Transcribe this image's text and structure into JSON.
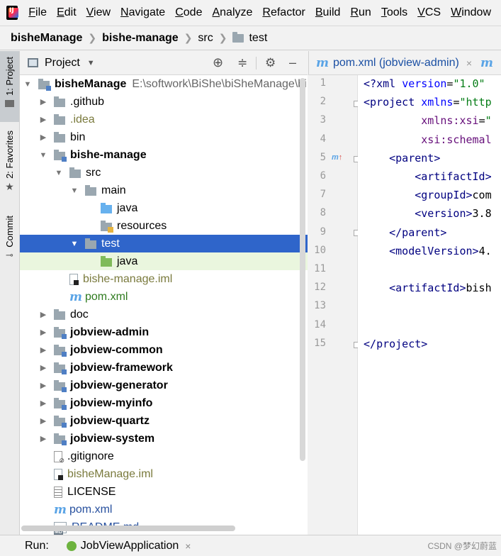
{
  "menubar": {
    "items": [
      "File",
      "Edit",
      "View",
      "Navigate",
      "Code",
      "Analyze",
      "Refactor",
      "Build",
      "Run",
      "Tools",
      "VCS",
      "Window"
    ]
  },
  "breadcrumb": {
    "items": [
      "bisheManage",
      "bishe-manage",
      "src",
      "test"
    ]
  },
  "left_stripe": {
    "project_label": "1: Project",
    "favorites_label": "2: Favorites",
    "commit_label": "Commit"
  },
  "project_panel": {
    "title": "Project",
    "tree": [
      {
        "label": "bisheManage",
        "extra": "E:\\softwork\\BiShe\\biSheManage\\bi",
        "indent": 0,
        "expanded": true,
        "icon": "module-folder",
        "bold": true
      },
      {
        "label": ".github",
        "indent": 1,
        "expanded": false,
        "icon": "folder"
      },
      {
        "label": ".idea",
        "indent": 1,
        "expanded": false,
        "icon": "folder",
        "color": "olive"
      },
      {
        "label": "bin",
        "indent": 1,
        "expanded": false,
        "icon": "folder"
      },
      {
        "label": "bishe-manage",
        "indent": 1,
        "expanded": true,
        "icon": "module-folder",
        "bold": true
      },
      {
        "label": "src",
        "indent": 2,
        "expanded": true,
        "icon": "folder"
      },
      {
        "label": "main",
        "indent": 3,
        "expanded": true,
        "icon": "folder"
      },
      {
        "label": "java",
        "indent": 4,
        "icon": "source-folder"
      },
      {
        "label": "resources",
        "indent": 4,
        "icon": "resources-folder"
      },
      {
        "label": "test",
        "indent": 3,
        "expanded": true,
        "icon": "folder",
        "selected": true
      },
      {
        "label": "java",
        "indent": 4,
        "icon": "test-folder",
        "highlight": true
      },
      {
        "label": "bishe-manage.iml",
        "indent": 2,
        "icon": "iml-file",
        "color": "olive"
      },
      {
        "label": "pom.xml",
        "indent": 2,
        "icon": "maven-file",
        "color": "green"
      },
      {
        "label": "doc",
        "indent": 1,
        "expanded": false,
        "icon": "folder"
      },
      {
        "label": "jobview-admin",
        "indent": 1,
        "expanded": false,
        "icon": "module-folder",
        "bold": true
      },
      {
        "label": "jobview-common",
        "indent": 1,
        "expanded": false,
        "icon": "module-folder",
        "bold": true
      },
      {
        "label": "jobview-framework",
        "indent": 1,
        "expanded": false,
        "icon": "module-folder",
        "bold": true
      },
      {
        "label": "jobview-generator",
        "indent": 1,
        "expanded": false,
        "icon": "module-folder",
        "bold": true
      },
      {
        "label": "jobview-myinfo",
        "indent": 1,
        "expanded": false,
        "icon": "module-folder",
        "bold": true
      },
      {
        "label": "jobview-quartz",
        "indent": 1,
        "expanded": false,
        "icon": "module-folder",
        "bold": true
      },
      {
        "label": "jobview-system",
        "indent": 1,
        "expanded": false,
        "icon": "module-folder",
        "bold": true
      },
      {
        "label": ".gitignore",
        "indent": 1,
        "icon": "gitignore-file"
      },
      {
        "label": "bisheManage.iml",
        "indent": 1,
        "icon": "iml-file",
        "color": "olive"
      },
      {
        "label": "LICENSE",
        "indent": 1,
        "icon": "license-file"
      },
      {
        "label": "pom.xml",
        "indent": 1,
        "icon": "maven-file",
        "color": "blue"
      },
      {
        "label": "README.md",
        "indent": 1,
        "icon": "md-file",
        "color": "blue"
      }
    ]
  },
  "editor": {
    "active_tab": "pom.xml (jobview-admin)",
    "line_numbers": [
      "1",
      "2",
      "3",
      "4",
      "5",
      "6",
      "7",
      "8",
      "9",
      "10",
      "11",
      "12",
      "13",
      "14",
      "15"
    ],
    "lines": [
      [
        {
          "t": "<?",
          "c": "tag"
        },
        {
          "t": "xml ",
          "c": "tag"
        },
        {
          "t": "version",
          "c": "attr"
        },
        {
          "t": "=",
          "c": "plain"
        },
        {
          "t": "\"1.0\"",
          "c": "str"
        }
      ],
      [
        {
          "t": "<",
          "c": "tag"
        },
        {
          "t": "project ",
          "c": "tag"
        },
        {
          "t": "xmlns",
          "c": "attr"
        },
        {
          "t": "=",
          "c": "plain"
        },
        {
          "t": "\"http",
          "c": "str"
        }
      ],
      [
        {
          "t": "         ",
          "c": "plain"
        },
        {
          "t": "xmlns:xsi",
          "c": "ns"
        },
        {
          "t": "=",
          "c": "plain"
        },
        {
          "t": "\"",
          "c": "str"
        }
      ],
      [
        {
          "t": "         ",
          "c": "plain"
        },
        {
          "t": "xsi:schemal",
          "c": "ns"
        }
      ],
      [
        {
          "t": "    ",
          "c": "plain"
        },
        {
          "t": "<parent>",
          "c": "tag"
        }
      ],
      [
        {
          "t": "        ",
          "c": "plain"
        },
        {
          "t": "<artifactId>",
          "c": "tag"
        }
      ],
      [
        {
          "t": "        ",
          "c": "plain"
        },
        {
          "t": "<groupId>",
          "c": "tag"
        },
        {
          "t": "com",
          "c": "plain"
        }
      ],
      [
        {
          "t": "        ",
          "c": "plain"
        },
        {
          "t": "<version>",
          "c": "tag"
        },
        {
          "t": "3.8",
          "c": "plain"
        }
      ],
      [
        {
          "t": "    ",
          "c": "plain"
        },
        {
          "t": "</parent>",
          "c": "tag"
        }
      ],
      [
        {
          "t": "    ",
          "c": "plain"
        },
        {
          "t": "<modelVersion>",
          "c": "tag"
        },
        {
          "t": "4.",
          "c": "plain"
        }
      ],
      [],
      [
        {
          "t": "    ",
          "c": "plain"
        },
        {
          "t": "<artifactId>",
          "c": "tag"
        },
        {
          "t": "bish",
          "c": "plain"
        }
      ],
      [],
      [],
      [
        {
          "t": "</",
          "c": "tag"
        },
        {
          "t": "project",
          "c": "tag"
        },
        {
          "t": ">",
          "c": "tag"
        }
      ]
    ]
  },
  "runbar": {
    "label": "Run:",
    "config": "JobViewApplication"
  },
  "watermark": "CSDN @梦幻蔚蓝"
}
